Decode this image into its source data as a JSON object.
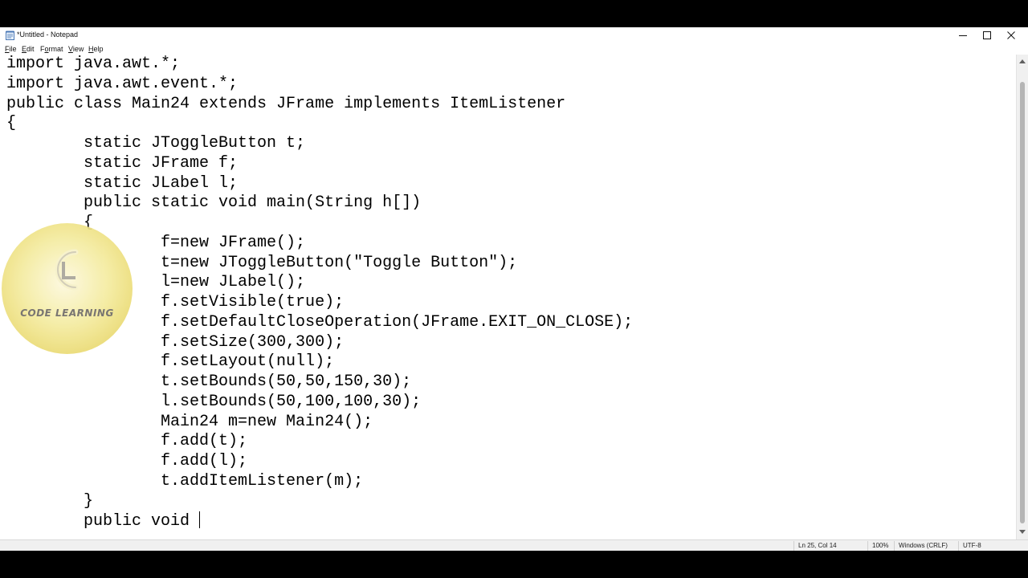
{
  "window": {
    "title": "*Untitled - Notepad"
  },
  "menu": {
    "items": [
      {
        "underline": "F",
        "rest": "ile"
      },
      {
        "underline": "E",
        "rest": "dit"
      },
      {
        "pre": "F",
        "underline": "o",
        "rest": "rmat"
      },
      {
        "underline": "V",
        "rest": "iew"
      },
      {
        "underline": "H",
        "rest": "elp"
      }
    ]
  },
  "editor": {
    "content": "import java.awt.*;\nimport java.awt.event.*;\npublic class Main24 extends JFrame implements ItemListener\n{\n\tstatic JToggleButton t;\n\tstatic JFrame f;\n\tstatic JLabel l;\n\tpublic static void main(String h[])\n\t{\n\t\tf=new JFrame();\n\t\tt=new JToggleButton(\"Toggle Button\");\n\t\tl=new JLabel();\n\t\tf.setVisible(true);\n\t\tf.setDefaultCloseOperation(JFrame.EXIT_ON_CLOSE);\n\t\tf.setSize(300,300);\n\t\tf.setLayout(null);\n\t\tt.setBounds(50,50,150,30);\n\t\tl.setBounds(50,100,100,30);\n\t\tMain24 m=new Main24();\n\t\tf.add(t);\n\t\tf.add(l);\n\t\tt.addItemListener(m);\n\t}\n\tpublic void "
  },
  "status": {
    "position": "Ln 25, Col 14",
    "zoom": "100%",
    "line_ending": "Windows (CRLF)",
    "encoding": "UTF-8"
  },
  "watermark": {
    "text": "CODE LEARNING"
  },
  "icons": {
    "app": "notepad-icon",
    "minimize": "minimize-icon",
    "maximize": "maximize-icon",
    "close": "close-icon",
    "logo": "code-learning-logo-icon"
  },
  "colors": {
    "window_bg": "#ffffff",
    "statusbar_bg": "#f0f0f0",
    "text": "#000000",
    "logo_gold": "#f4eb9e"
  }
}
